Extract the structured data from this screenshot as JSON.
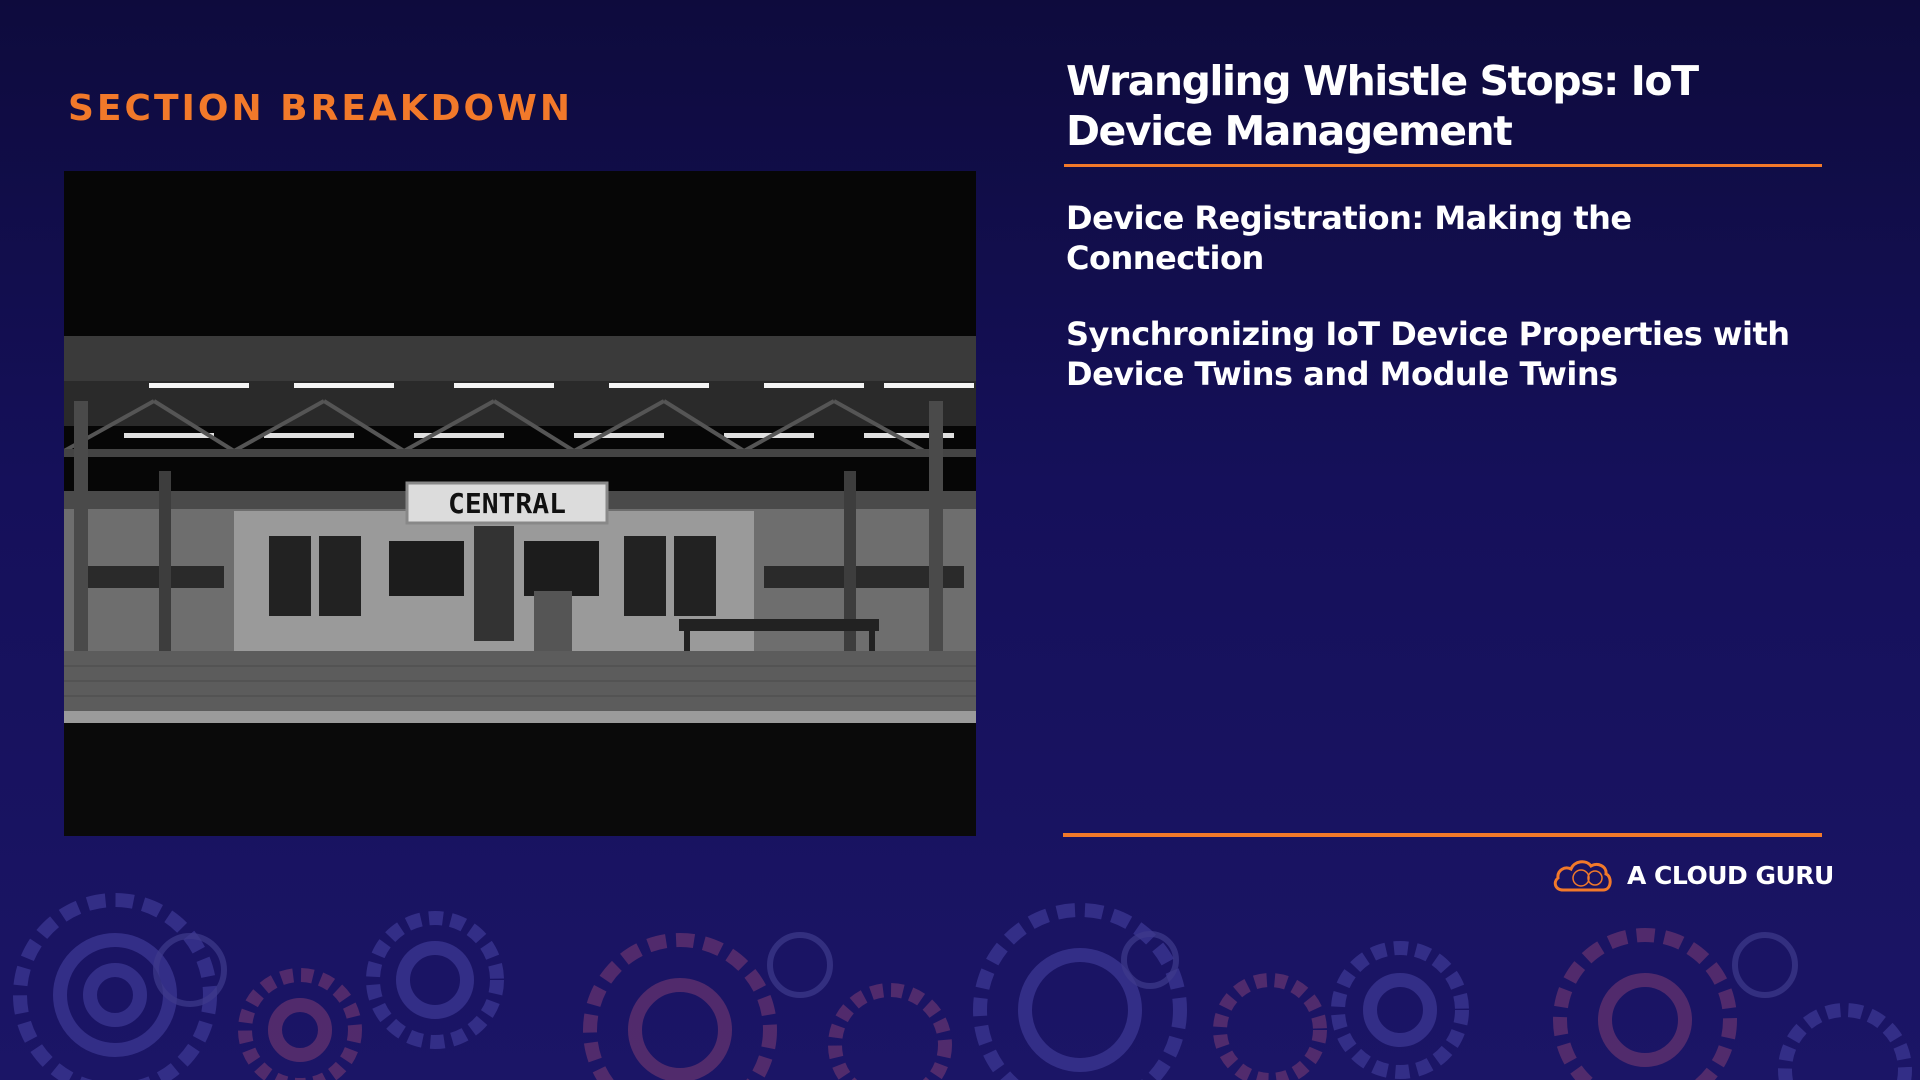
{
  "section": {
    "label": "SECTION BREAKDOWN"
  },
  "slide": {
    "title": "Wrangling Whistle Stops: IoT Device Management",
    "items": [
      "Device Registration: Making the Connection",
      "Synchronizing IoT Device Properties with Device Twins and Module Twins"
    ]
  },
  "photo": {
    "sign_text": "CENTRAL"
  },
  "brand": {
    "name": "A CLOUD GURU",
    "icon": "cloud-icon"
  },
  "colors": {
    "accent": "#f2792a",
    "background": "#15105a",
    "text": "#ffffff"
  }
}
